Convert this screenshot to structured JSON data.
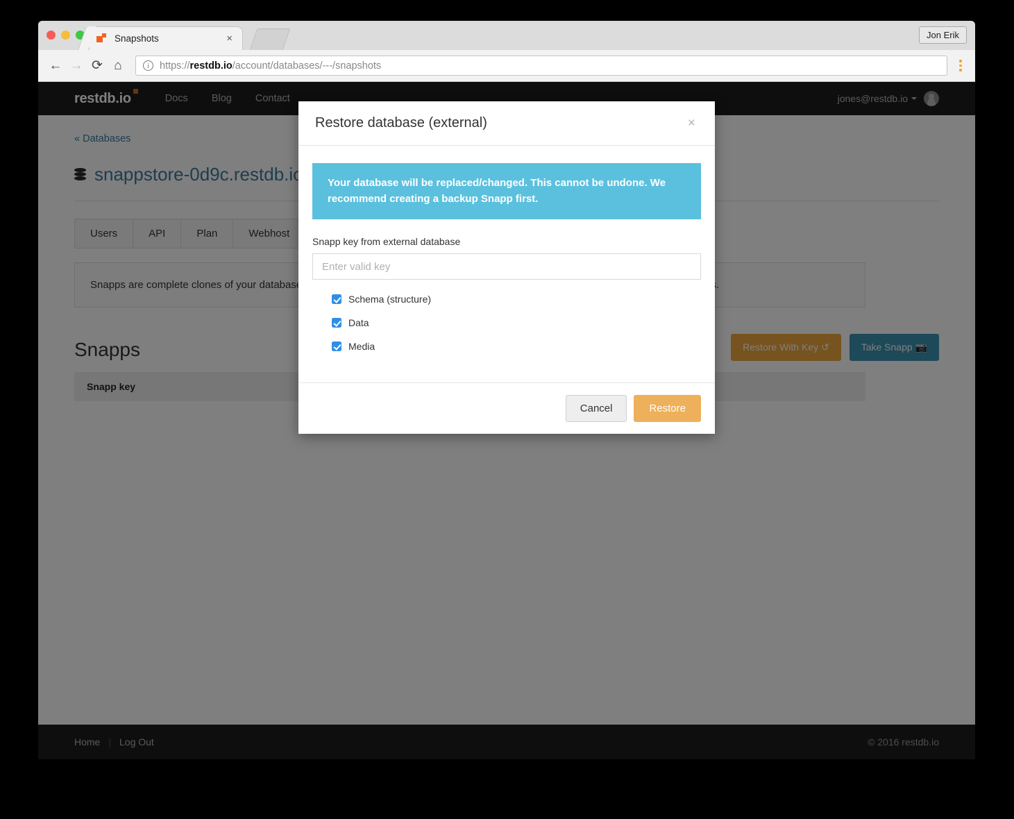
{
  "browser": {
    "tab": {
      "title": "Snapshots",
      "close_label": "×"
    },
    "profile_label": "Jon Erik",
    "url": {
      "scheme": "https://",
      "domain": "restdb.io",
      "path": "/account/databases/---/snapshots"
    },
    "back_icon": "←",
    "forward_icon": "→",
    "reload_icon": "⟳",
    "home_icon": "⌂"
  },
  "navbar": {
    "brand": "restdb.io",
    "links": [
      {
        "label": "Docs"
      },
      {
        "label": "Blog"
      },
      {
        "label": "Contact"
      }
    ],
    "user": "jones@restdb.io"
  },
  "content": {
    "breadcrumb": "« Databases",
    "database_name": "snappstore-0d9c.restdb.io",
    "external_link_icon": "⧉",
    "tabs": [
      {
        "label": "Users"
      },
      {
        "label": "API"
      },
      {
        "label": "Plan"
      },
      {
        "label": "Webhost"
      }
    ],
    "info_text": "Snapps are complete clones of your database. Great for staging environments (dev, test, prod) and for sharing your databases/solutions.",
    "section_title": "Snapps",
    "restore_with_key_label": "Restore With Key",
    "restore_with_key_icon": "↺",
    "take_snapp_label": "Take Snapp",
    "take_snapp_icon": "📷",
    "table_header": "Snapp key"
  },
  "footer": {
    "home": "Home",
    "logout": "Log Out",
    "copyright": "© 2016 restdb.io"
  },
  "modal": {
    "title": "Restore database (external)",
    "close_label": "×",
    "alert": "Your database will be replaced/changed. This cannot be undone. We recommend creating a backup Snapp first.",
    "field_label": "Snapp key from external database",
    "field_value": "",
    "field_placeholder": "Enter valid key",
    "checkboxes": [
      {
        "label": "Schema (structure)",
        "checked": true
      },
      {
        "label": "Data",
        "checked": true
      },
      {
        "label": "Media",
        "checked": true
      }
    ],
    "cancel_label": "Cancel",
    "restore_label": "Restore"
  },
  "colors": {
    "alert_blue": "#5bc0de",
    "accent_orange": "#eda63f",
    "accent_teal": "#3b92b0",
    "checkbox_blue": "#2f8fe8",
    "link_blue": "#3b7b9b"
  }
}
